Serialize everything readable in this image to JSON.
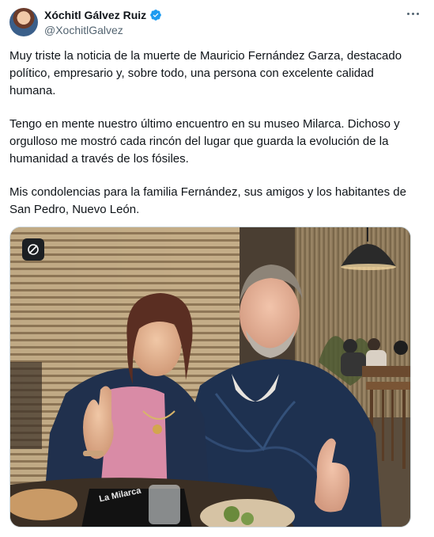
{
  "author": {
    "display_name": "Xóchitl Gálvez Ruiz",
    "handle": "@XochitlGalvez",
    "verified": true,
    "verified_color": "#1d9bf0"
  },
  "post": {
    "paragraphs": [
      "Muy triste la noticia de la muerte de Mauricio Fernández Garza, destacado político, empresario y,  sobre todo, una persona con excelente calidad humana.",
      "Tengo en mente nuestro último encuentro en su museo Milarca. Dichoso y orgulloso me mostró cada rincón del lugar que guarda la evolución de la humanidad a través de los fósiles.",
      "Mis condolencias para la familia Fernández, sus amigos y los habitantes de San Pedro, Nuevo León."
    ]
  },
  "media": {
    "menu_text": "La Milarca"
  },
  "icons": {
    "more": "more-options-icon",
    "verified": "verified-badge-icon",
    "grok": "grok-icon"
  }
}
